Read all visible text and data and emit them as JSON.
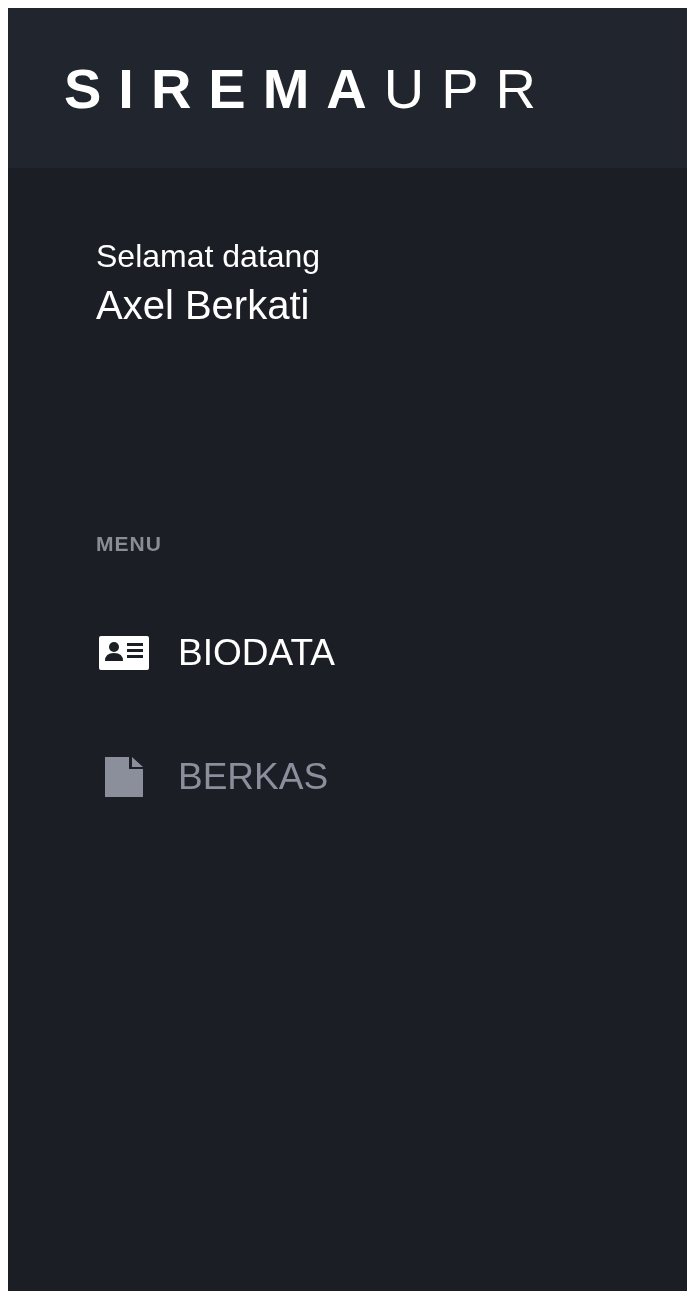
{
  "header": {
    "logo_bold": "SIREMA",
    "logo_light": "UPR"
  },
  "sidebar": {
    "greeting": "Selamat datang",
    "user_name": "Axel Berkati",
    "section_label": "MENU",
    "items": [
      {
        "label": "BIODATA",
        "kind": "id-card",
        "selected": true
      },
      {
        "label": "BERKAS",
        "kind": "file",
        "selected": false
      }
    ]
  }
}
